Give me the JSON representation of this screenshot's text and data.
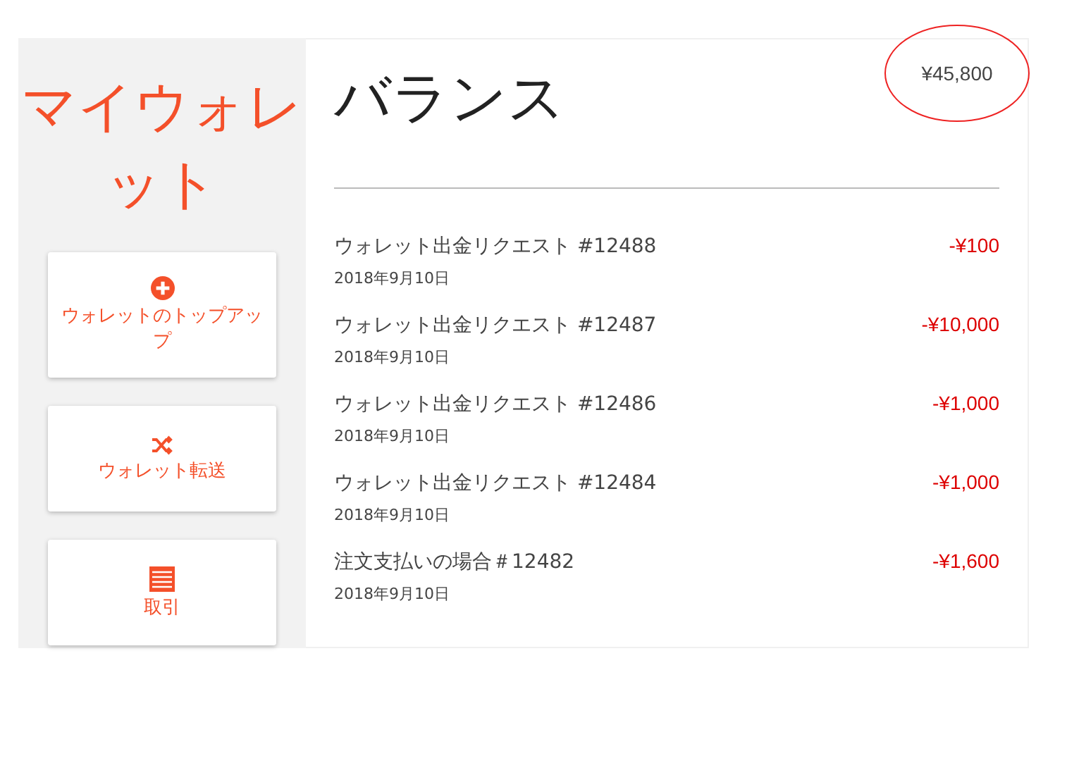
{
  "sidebar": {
    "title": "マイウォレット",
    "actions": [
      {
        "kind": "topup",
        "label": "ウォレットのトップアップ"
      },
      {
        "kind": "transfer",
        "label": "ウォレット転送"
      },
      {
        "kind": "transactions",
        "label": "取引"
      }
    ]
  },
  "balance": {
    "title": "バランス",
    "amount": "¥45,800"
  },
  "transactions": [
    {
      "title": "ウォレット出金リクエスト #12488",
      "date": "2018年9月10日",
      "amount": "-¥100"
    },
    {
      "title": "ウォレット出金リクエスト #12487",
      "date": "2018年9月10日",
      "amount": "-¥10,000"
    },
    {
      "title": "ウォレット出金リクエスト #12486",
      "date": "2018年9月10日",
      "amount": "-¥1,000"
    },
    {
      "title": "ウォレット出金リクエスト #12484",
      "date": "2018年9月10日",
      "amount": "-¥1,000"
    },
    {
      "title": "注文支払いの場合＃12482",
      "date": "2018年9月10日",
      "amount": "-¥1,600"
    }
  ]
}
